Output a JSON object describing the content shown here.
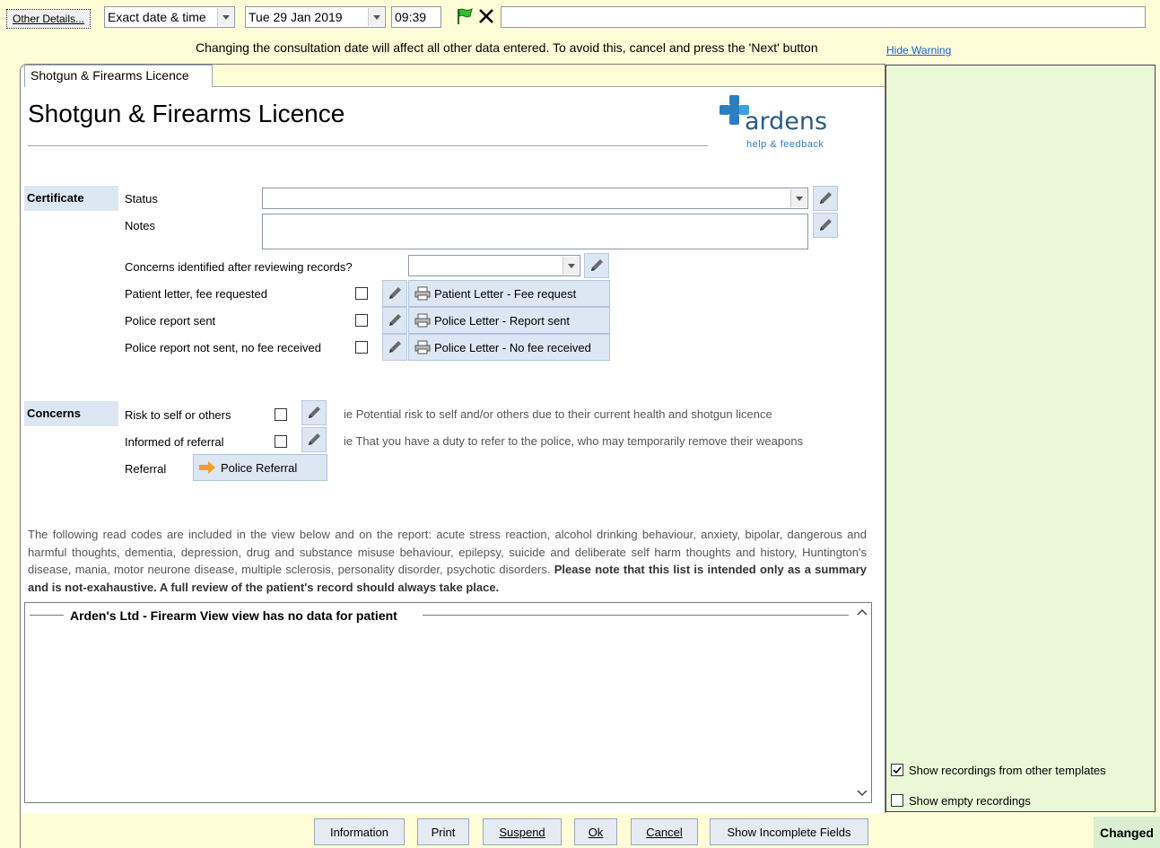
{
  "toolbar": {
    "other_details_label": "Other Details...",
    "date_mode_value": "Exact date & time",
    "date_value": "Tue 29 Jan 2019",
    "time_value": "09:39",
    "free_text_value": ""
  },
  "warning": {
    "text": "Changing the consultation date will affect all other data entered. To avoid this, cancel and press the 'Next' button",
    "hide_link": "Hide Warning"
  },
  "tab": {
    "label": "Shotgun & Firearms Licence"
  },
  "form": {
    "title": "Shotgun & Firearms Licence",
    "logo_text": "ardens",
    "logo_sub": "help & feedback"
  },
  "certificate": {
    "section_label": "Certificate",
    "status_label": "Status",
    "status_value": "",
    "notes_label": "Notes",
    "notes_value": "",
    "concerns_question": "Concerns identified after reviewing records?",
    "concerns_value": "",
    "rows": [
      {
        "label": "Patient letter, fee requested",
        "checked": false,
        "button": "Patient Letter - Fee request"
      },
      {
        "label": "Police report sent",
        "checked": false,
        "button": "Police Letter - Report sent"
      },
      {
        "label": "Police report not sent, no fee received",
        "checked": false,
        "button": "Police Letter - No fee received"
      }
    ]
  },
  "concerns": {
    "section_label": "Concerns",
    "risk_label": "Risk to self or others",
    "risk_hint": "ie Potential risk to self and/or others due to their current health and shotgun licence",
    "informed_label": "Informed of referral",
    "informed_hint": "ie That you have a duty to refer to the police, who may temporarily remove their weapons",
    "referral_label": "Referral",
    "referral_button": "Police Referral"
  },
  "info_paragraph": {
    "normal": "The following read codes are included in the view below and on the report: acute stress reaction, alcohol drinking behaviour, anxiety, bipolar, dangerous and harmful thoughts, dementia, depression, drug and substance misuse behaviour, epilepsy, suicide and deliberate self harm thoughts and history, Huntington's disease, mania, motor neurone disease, multiple sclerosis, personality disorder, psychotic disorders. ",
    "bold": "Please note that this list is intended only as a summary and is not-exahaustive. A full review of the patient's record should always take place."
  },
  "view_panel": {
    "title": "Arden's Ltd - Firearm View view has no data for patient"
  },
  "right_panel": {
    "show_other_templates": "Show recordings from other templates",
    "show_other_checked": true,
    "show_empty": "Show empty recordings",
    "show_empty_checked": false
  },
  "bottom_buttons": {
    "information": "Information",
    "print": "Print",
    "suspend": "Suspend",
    "ok": "Ok",
    "cancel": "Cancel",
    "show_incomplete": "Show Incomplete Fields"
  },
  "status": {
    "changed": "Changed"
  },
  "colors": {
    "background": "#fffcd8",
    "section_bg": "#dde6f3",
    "right_panel": "#eaf8d8",
    "changed_bg": "#d8f0d0",
    "logo_blue": "#1f8fd1",
    "link": "#1a5fd0"
  }
}
